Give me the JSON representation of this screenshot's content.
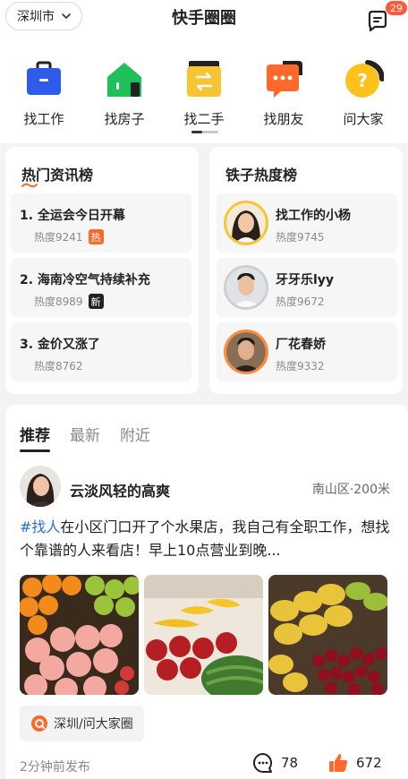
{
  "header": {
    "city": "深圳市",
    "title": "快手圈圈",
    "message_count": "29"
  },
  "categories": [
    {
      "label": "找工作",
      "icon": "briefcase-icon",
      "color": "#2f5bea"
    },
    {
      "label": "找房子",
      "icon": "house-icon",
      "color": "#1fbf5a"
    },
    {
      "label": "找二手",
      "icon": "exchange-box-icon",
      "color": "#f7c531"
    },
    {
      "label": "找朋友",
      "icon": "chat-bubble-icon",
      "color": "#ff6a2c"
    },
    {
      "label": "问大家",
      "icon": "question-icon",
      "color": "#ffc21c"
    }
  ],
  "hot_news": {
    "title": "热门资讯榜",
    "items": [
      {
        "text": "1. 全运会今日开幕",
        "heat": "热度9241",
        "tag": "热",
        "tag_color": "#ff6a2c"
      },
      {
        "text": "2. 海南冷空气持续补充",
        "heat": "热度8989",
        "tag": "新",
        "tag_color": "#222222"
      },
      {
        "text": "3. 金价又涨了",
        "heat": "热度8762",
        "tag": "",
        "tag_color": ""
      }
    ]
  },
  "fan_rank": {
    "title": "铁子热度榜",
    "items": [
      {
        "name": "找工作的小杨",
        "heat": "热度9745",
        "ring": "#f7c531"
      },
      {
        "name": "牙牙乐lyy",
        "heat": "热度9672",
        "ring": "#cfcfcf"
      },
      {
        "name": "厂花春娇",
        "heat": "热度9332",
        "ring": "#ff8a3c"
      }
    ]
  },
  "feed": {
    "tabs": [
      "推荐",
      "最新",
      "附近"
    ],
    "post": {
      "author": "云淡风轻的高爽",
      "location": "南山区·200米",
      "hashtag": "#找人",
      "text": "在小区门口开了个水果店，我自己有全职工作，想找个靠谱的人来看店！早上10点营业到晚...",
      "circle": "深圳/问大家圈",
      "time": "2分钟前发布",
      "comments": "78",
      "likes": "672"
    }
  }
}
